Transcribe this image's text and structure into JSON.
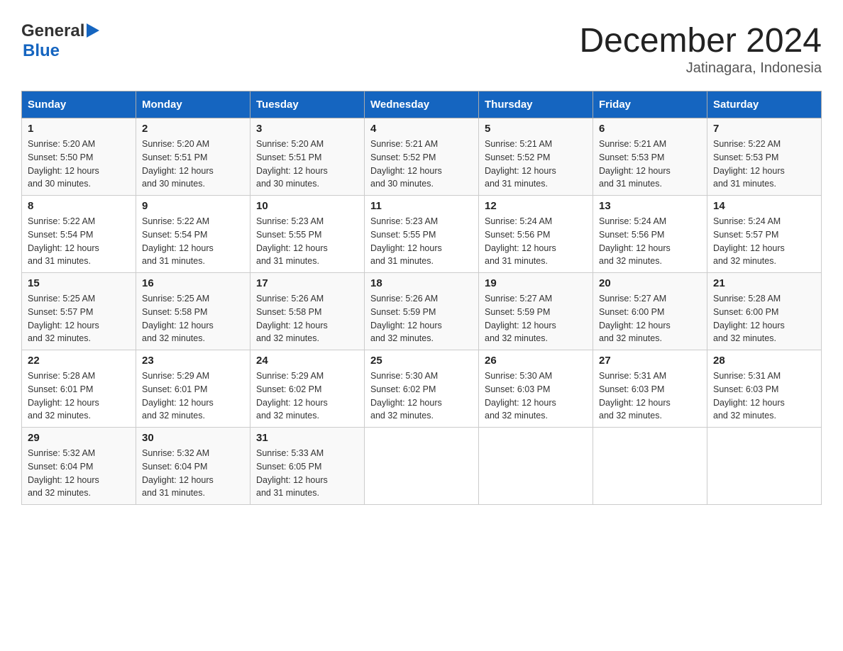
{
  "header": {
    "logo_general": "General",
    "logo_blue": "Blue",
    "month_title": "December 2024",
    "subtitle": "Jatinagara, Indonesia"
  },
  "days_of_week": [
    "Sunday",
    "Monday",
    "Tuesday",
    "Wednesday",
    "Thursday",
    "Friday",
    "Saturday"
  ],
  "weeks": [
    [
      {
        "day": "1",
        "sunrise": "5:20 AM",
        "sunset": "5:50 PM",
        "daylight": "12 hours and 30 minutes."
      },
      {
        "day": "2",
        "sunrise": "5:20 AM",
        "sunset": "5:51 PM",
        "daylight": "12 hours and 30 minutes."
      },
      {
        "day": "3",
        "sunrise": "5:20 AM",
        "sunset": "5:51 PM",
        "daylight": "12 hours and 30 minutes."
      },
      {
        "day": "4",
        "sunrise": "5:21 AM",
        "sunset": "5:52 PM",
        "daylight": "12 hours and 30 minutes."
      },
      {
        "day": "5",
        "sunrise": "5:21 AM",
        "sunset": "5:52 PM",
        "daylight": "12 hours and 31 minutes."
      },
      {
        "day": "6",
        "sunrise": "5:21 AM",
        "sunset": "5:53 PM",
        "daylight": "12 hours and 31 minutes."
      },
      {
        "day": "7",
        "sunrise": "5:22 AM",
        "sunset": "5:53 PM",
        "daylight": "12 hours and 31 minutes."
      }
    ],
    [
      {
        "day": "8",
        "sunrise": "5:22 AM",
        "sunset": "5:54 PM",
        "daylight": "12 hours and 31 minutes."
      },
      {
        "day": "9",
        "sunrise": "5:22 AM",
        "sunset": "5:54 PM",
        "daylight": "12 hours and 31 minutes."
      },
      {
        "day": "10",
        "sunrise": "5:23 AM",
        "sunset": "5:55 PM",
        "daylight": "12 hours and 31 minutes."
      },
      {
        "day": "11",
        "sunrise": "5:23 AM",
        "sunset": "5:55 PM",
        "daylight": "12 hours and 31 minutes."
      },
      {
        "day": "12",
        "sunrise": "5:24 AM",
        "sunset": "5:56 PM",
        "daylight": "12 hours and 31 minutes."
      },
      {
        "day": "13",
        "sunrise": "5:24 AM",
        "sunset": "5:56 PM",
        "daylight": "12 hours and 32 minutes."
      },
      {
        "day": "14",
        "sunrise": "5:24 AM",
        "sunset": "5:57 PM",
        "daylight": "12 hours and 32 minutes."
      }
    ],
    [
      {
        "day": "15",
        "sunrise": "5:25 AM",
        "sunset": "5:57 PM",
        "daylight": "12 hours and 32 minutes."
      },
      {
        "day": "16",
        "sunrise": "5:25 AM",
        "sunset": "5:58 PM",
        "daylight": "12 hours and 32 minutes."
      },
      {
        "day": "17",
        "sunrise": "5:26 AM",
        "sunset": "5:58 PM",
        "daylight": "12 hours and 32 minutes."
      },
      {
        "day": "18",
        "sunrise": "5:26 AM",
        "sunset": "5:59 PM",
        "daylight": "12 hours and 32 minutes."
      },
      {
        "day": "19",
        "sunrise": "5:27 AM",
        "sunset": "5:59 PM",
        "daylight": "12 hours and 32 minutes."
      },
      {
        "day": "20",
        "sunrise": "5:27 AM",
        "sunset": "6:00 PM",
        "daylight": "12 hours and 32 minutes."
      },
      {
        "day": "21",
        "sunrise": "5:28 AM",
        "sunset": "6:00 PM",
        "daylight": "12 hours and 32 minutes."
      }
    ],
    [
      {
        "day": "22",
        "sunrise": "5:28 AM",
        "sunset": "6:01 PM",
        "daylight": "12 hours and 32 minutes."
      },
      {
        "day": "23",
        "sunrise": "5:29 AM",
        "sunset": "6:01 PM",
        "daylight": "12 hours and 32 minutes."
      },
      {
        "day": "24",
        "sunrise": "5:29 AM",
        "sunset": "6:02 PM",
        "daylight": "12 hours and 32 minutes."
      },
      {
        "day": "25",
        "sunrise": "5:30 AM",
        "sunset": "6:02 PM",
        "daylight": "12 hours and 32 minutes."
      },
      {
        "day": "26",
        "sunrise": "5:30 AM",
        "sunset": "6:03 PM",
        "daylight": "12 hours and 32 minutes."
      },
      {
        "day": "27",
        "sunrise": "5:31 AM",
        "sunset": "6:03 PM",
        "daylight": "12 hours and 32 minutes."
      },
      {
        "day": "28",
        "sunrise": "5:31 AM",
        "sunset": "6:03 PM",
        "daylight": "12 hours and 32 minutes."
      }
    ],
    [
      {
        "day": "29",
        "sunrise": "5:32 AM",
        "sunset": "6:04 PM",
        "daylight": "12 hours and 32 minutes."
      },
      {
        "day": "30",
        "sunrise": "5:32 AM",
        "sunset": "6:04 PM",
        "daylight": "12 hours and 31 minutes."
      },
      {
        "day": "31",
        "sunrise": "5:33 AM",
        "sunset": "6:05 PM",
        "daylight": "12 hours and 31 minutes."
      },
      null,
      null,
      null,
      null
    ]
  ]
}
